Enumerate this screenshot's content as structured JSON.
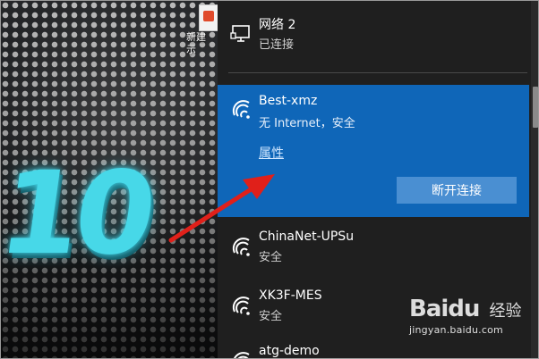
{
  "desktop": {
    "icon_label": "新建 \n示",
    "wallpaper_text": "10"
  },
  "network_flyout": {
    "wired": {
      "name": "网络 2",
      "status": "已连接",
      "icon": "ethernet-monitor-icon"
    },
    "selected": {
      "name": "Best-xmz",
      "status": "无 Internet，安全",
      "properties_link": "属性",
      "disconnect_button": "断开连接",
      "icon": "wifi-icon",
      "accent": "#0f66b8"
    },
    "networks": [
      {
        "name": "ChinaNet-UPSu",
        "status": "安全",
        "icon": "wifi-icon"
      },
      {
        "name": "XK3F-MES",
        "status": "安全",
        "icon": "wifi-icon"
      },
      {
        "name": "atg-demo",
        "status": "",
        "icon": "wifi-icon"
      }
    ]
  },
  "annotation": {
    "arrow_color": "#e0201a"
  },
  "watermark": {
    "logo": "Bai",
    "paw": "du",
    "cn": "经验",
    "url": "jingyan.baidu.com"
  }
}
